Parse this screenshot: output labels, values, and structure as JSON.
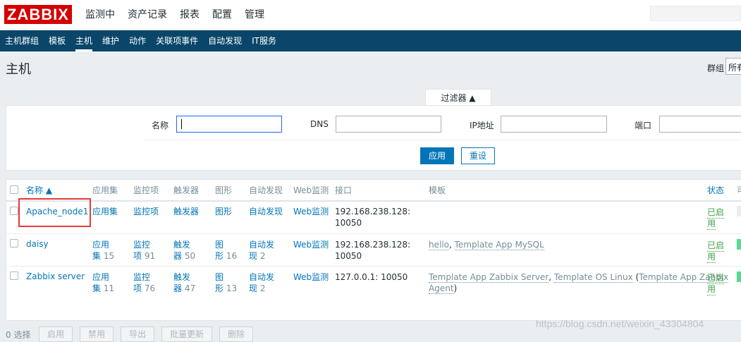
{
  "header": {
    "logo": "ZABBIX",
    "menu": [
      "监测中",
      "资产记录",
      "报表",
      "配置",
      "管理"
    ]
  },
  "submenu": [
    "主机群组",
    "模板",
    "主机",
    "维护",
    "动作",
    "关联项事件",
    "自动发现",
    "IT服务"
  ],
  "page": {
    "title": "主机",
    "group_label": "群组",
    "group_value": "所有"
  },
  "filter": {
    "tab_label": "过滤器 ▲",
    "name_label": "名称",
    "dns_label": "DNS",
    "ip_label": "IP地址",
    "port_label": "端口",
    "apply": "应用",
    "reset": "重设"
  },
  "table": {
    "headers": {
      "name": "名称 ▲",
      "apps": "应用集",
      "items": "监控项",
      "triggers": "触发器",
      "graphs": "图形",
      "discovery": "自动发现",
      "web": "Web监测",
      "interface": "接口",
      "templates": "模板",
      "status": "状态",
      "avail": "可"
    },
    "rows": [
      {
        "name": "Apache_node1",
        "apps": "应用集",
        "apps_count": "",
        "items": "监控项",
        "items_count": "",
        "triggers": "触发器",
        "triggers_count": "",
        "graphs": "图形",
        "graphs_count": "",
        "discovery": "自动发现",
        "discovery_count": "",
        "web": "Web监测",
        "interface_1": "192.168.238.128:",
        "interface_2": "10050",
        "template_1": "",
        "template_2": "",
        "template_3": "",
        "status_1": "已启",
        "status_2": "用"
      },
      {
        "name": "daisy",
        "apps": "应用",
        "apps_2": "集",
        "apps_count": "15",
        "items": "监控",
        "items_2": "项",
        "items_count": "91",
        "triggers": "触发",
        "triggers_2": "器",
        "triggers_count": "50",
        "graphs": "图",
        "graphs_2": "形",
        "graphs_count": "16",
        "discovery": "自动发",
        "discovery_2": "现",
        "discovery_count": "2",
        "web": "Web监测",
        "interface_1": "192.168.238.128:",
        "interface_2": "10050",
        "template_1": "hello",
        "template_2": "Template App MySQL",
        "status_1": "已启",
        "status_2": "用"
      },
      {
        "name": "Zabbix server",
        "apps": "应用",
        "apps_2": "集",
        "apps_count": "11",
        "items": "监控",
        "items_2": "项",
        "items_count": "76",
        "triggers": "触发",
        "triggers_2": "器",
        "triggers_count": "47",
        "graphs": "图",
        "graphs_2": "形",
        "graphs_count": "13",
        "discovery": "自动发",
        "discovery_2": "现",
        "discovery_count": "2",
        "web": "Web监测",
        "interface_1": "127.0.0.1: 10050",
        "template_1": "Template App Zabbix Server",
        "template_2": "Template OS Linux",
        "template_3": "Template App Zabbix",
        "template_4": "Agent",
        "status_1": "已启",
        "status_2": "用"
      }
    ]
  },
  "footer": {
    "selected": "0 选择",
    "buttons": [
      "启用",
      "禁用",
      "导出",
      "批量更新",
      "删除"
    ]
  },
  "watermark": "https://blog.csdn.net/weixin_43304804"
}
